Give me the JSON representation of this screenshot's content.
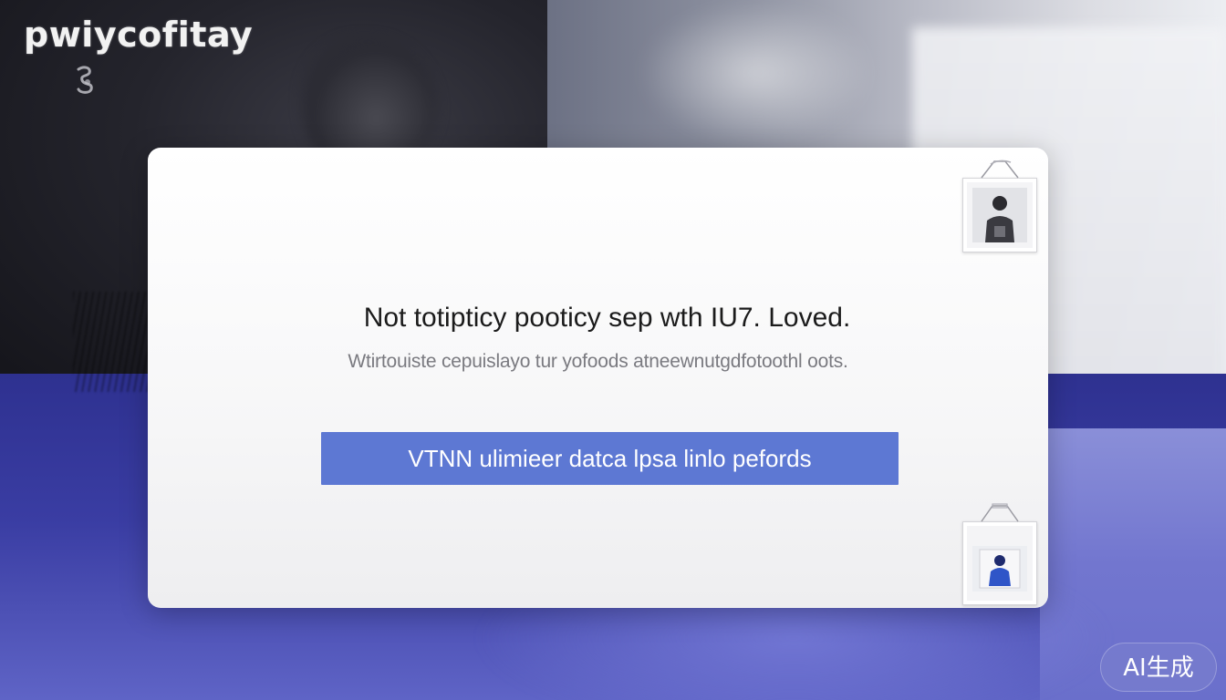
{
  "brand": {
    "name": "pwiycofitay"
  },
  "dialog": {
    "title": "Not totipticy pooticy sep wth IU7. Loved.",
    "subtitle": "Wtirtouiste cepuislayo tur yofoods atneewnutgdfotoothl oots.",
    "cta_label": "VTNN ulimieer datca lpsa linlo pefords"
  },
  "thumbnails": [
    {
      "icon": "person-photo-icon",
      "tone": "dark"
    },
    {
      "icon": "person-photo-icon",
      "tone": "blue"
    }
  ],
  "badge": {
    "label": "AI生成"
  },
  "colors": {
    "cta": "#5d78d3",
    "bottom_band": "#3a3da3",
    "dialog_bg": "#f7f7f8"
  }
}
